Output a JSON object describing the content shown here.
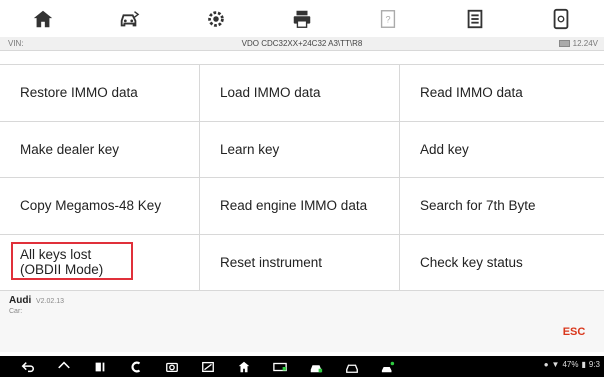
{
  "toolbar": {
    "buttons": [
      {
        "icon": "home-icon"
      },
      {
        "icon": "vehicle-swap-icon"
      },
      {
        "icon": "settings-gear-icon"
      },
      {
        "icon": "print-icon"
      },
      {
        "icon": "help-icon"
      },
      {
        "icon": "data-record-icon"
      },
      {
        "icon": "screenshot-icon"
      }
    ]
  },
  "vin_bar": {
    "label": "VIN:",
    "vehicle": "VDO CDC32XX+24C32 A3\\TT\\R8",
    "voltage": "12.24V"
  },
  "functions": [
    {
      "label": "Restore IMMO data"
    },
    {
      "label": "Load IMMO data"
    },
    {
      "label": "Read IMMO data"
    },
    {
      "label": "Make dealer key"
    },
    {
      "label": "Learn key"
    },
    {
      "label": "Add key"
    },
    {
      "label": "Copy Megamos-48 Key"
    },
    {
      "label": "Read engine IMMO data"
    },
    {
      "label": "Search for 7th Byte"
    },
    {
      "label": "All keys lost (OBDII Mode)",
      "highlighted": true
    },
    {
      "label": "Reset instrument"
    },
    {
      "label": "Check key status"
    }
  ],
  "footer": {
    "make": "Audi",
    "version": "V2.02.13",
    "car_label": "Car:",
    "esc_label": "ESC"
  },
  "status_bar": {
    "battery_percent": "47%",
    "time": "9:3"
  },
  "colors": {
    "accent_red": "#d9371c",
    "highlight_border": "#e0303a"
  }
}
